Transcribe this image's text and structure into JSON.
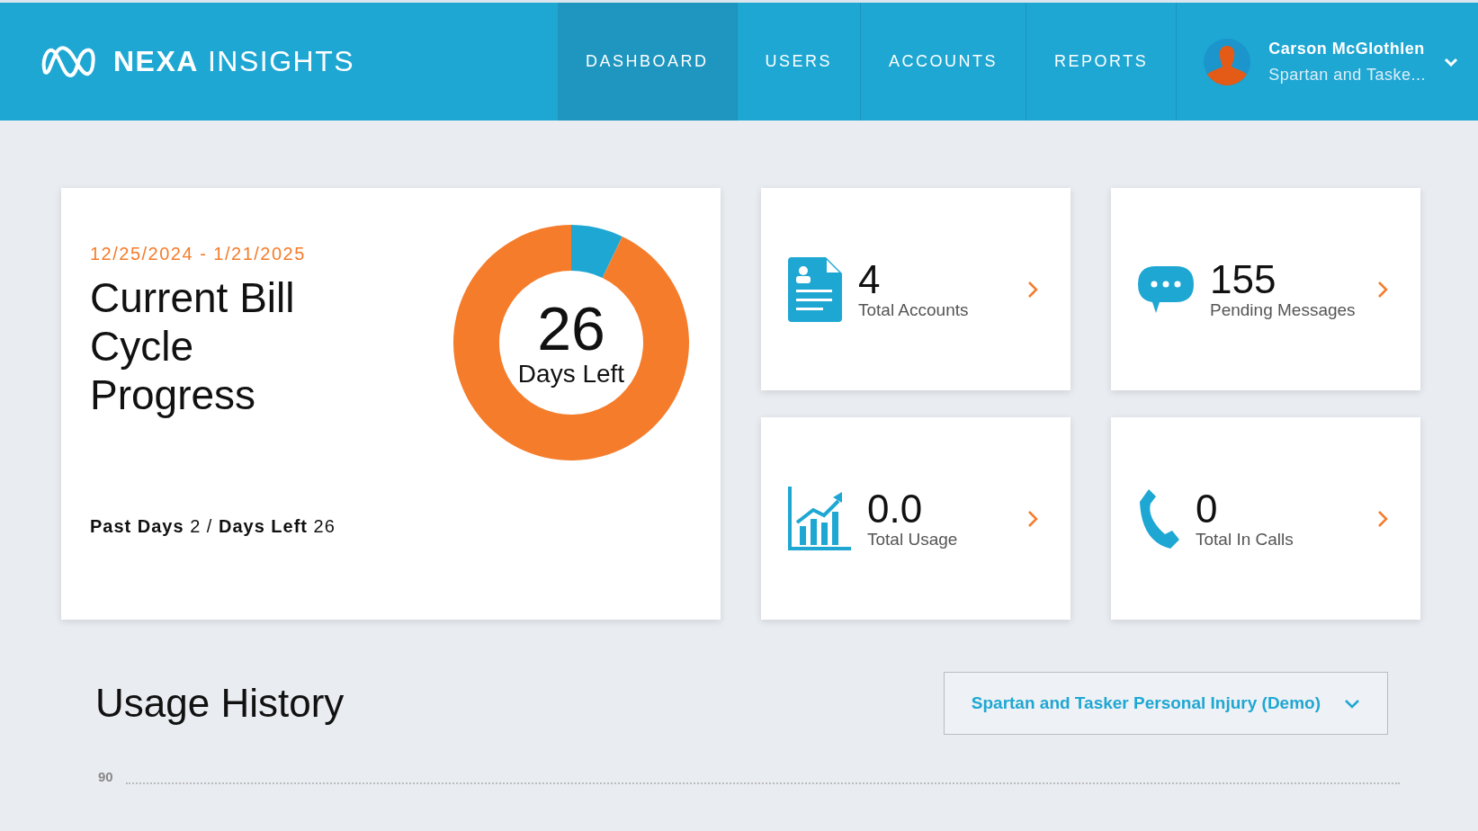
{
  "header": {
    "brand_bold": "NEXA",
    "brand_light": "INSIGHTS",
    "nav": [
      {
        "label": "DASHBOARD",
        "selected": true
      },
      {
        "label": "USERS",
        "selected": false
      },
      {
        "label": "ACCOUNTS",
        "selected": false
      },
      {
        "label": "REPORTS",
        "selected": false
      }
    ],
    "user": {
      "name": "Carson McGlothlen",
      "company": "Spartan and Taske..."
    }
  },
  "bill_cycle": {
    "date_range": "12/25/2024 - 1/21/2025",
    "title": "Current Bill Cycle Progress",
    "summary": "**Past Days** 2 / **Days Left** 26",
    "center_value": "26",
    "center_label": "Days Left",
    "chart_data": {
      "type": "donut",
      "values": [
        7.14,
        92.86
      ]
    }
  },
  "stats": [
    {
      "kind": "accounts",
      "value": "4",
      "label": "Total Accounts"
    },
    {
      "kind": "messages",
      "value": "155",
      "label": "Pending Messages"
    },
    {
      "kind": "usage",
      "value": "0.0",
      "label": "Total Usage"
    },
    {
      "kind": "calls",
      "value": "0",
      "label": "Total In Calls"
    }
  ],
  "usage_history": {
    "title": "Usage History",
    "account_select": "Spartan and Tasker Personal Injury (Demo)",
    "axis_tick": "90"
  }
}
